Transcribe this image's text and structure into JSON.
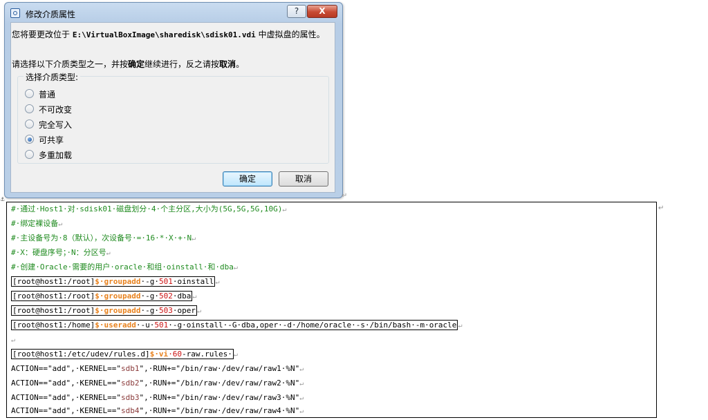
{
  "dialog": {
    "title": "修改介质属性",
    "help_label": "?",
    "close_label": "X",
    "msg_prefix": "您将要更改位于",
    "msg_path": "E:\\VirtualBoxImage\\sharedisk\\sdisk01.vdi",
    "msg_suffix": "中虚拟盘的属性。",
    "instr_part1": "请选择以下介质类型之一，并按",
    "instr_ok": "确定",
    "instr_part2": "继续进行，反之请按",
    "instr_cancel": "取消",
    "instr_end": "。",
    "group_label": "选择介质类型:",
    "options": [
      {
        "label": "普通",
        "checked": false
      },
      {
        "label": "不可改变",
        "checked": false
      },
      {
        "label": "完全写入",
        "checked": false
      },
      {
        "label": "可共享",
        "checked": true
      },
      {
        "label": "多重加载",
        "checked": false
      }
    ],
    "ok_label": "确定",
    "cancel_label": "取消"
  },
  "code": {
    "comments": [
      "#·通过·Host1·对·sdisk01·磁盘划分·4·个主分区,大小为(5G,5G,5G,10G)",
      "#·绑定裸设备",
      "#·主设备号为·8（默认），次设备号·=·16·*·X·+·N",
      "#·X：硬盘序号；·N：分区号",
      "#·创建·Oracle·需要的用户·oracle·和组·oinstall·和·dba"
    ],
    "commands": [
      {
        "prompt": "[root@host1:/root]",
        "cmd": "·groupadd",
        "args_pre": "·-g·",
        "num": "501",
        "args_post": "·oinstall"
      },
      {
        "prompt": "[root@host1:/root]",
        "cmd": "·groupadd",
        "args_pre": "·-g·",
        "num": "502",
        "args_post": "·dba"
      },
      {
        "prompt": "[root@host1:/root]",
        "cmd": "·groupadd",
        "args_pre": "·-g·",
        "num": "503",
        "args_post": "·oper"
      },
      {
        "prompt": "[root@host1:/home]",
        "cmd": "·useradd",
        "args_pre": "·-u·",
        "num": "501",
        "args_post": "·-g·oinstall·-G·dba,oper·-d·/home/oracle·-s·/bin/bash·-m·oracle"
      }
    ],
    "vi_line": {
      "prompt": "[root@host1:/etc/udev/rules.d]",
      "cmd": "·vi",
      "num": "·60",
      "rest": "-raw.rules·"
    },
    "rules": [
      {
        "pre": "ACTION==\"add\",·KERNEL==\"",
        "dev": "sdb1",
        "post": "\",·RUN+=\"/bin/raw·/dev/raw/raw1·%N\""
      },
      {
        "pre": "ACTION==\"add\",·KERNEL==\"",
        "dev": "sdb2",
        "post": "\",·RUN+=\"/bin/raw·/dev/raw/raw2·%N\""
      },
      {
        "pre": "ACTION==\"add\",·KERNEL==\"",
        "dev": "sdb3",
        "post": "\",·RUN+=\"/bin/raw·/dev/raw/raw3·%N\""
      },
      {
        "pre": "ACTION==\"add\",·KERNEL==\"",
        "dev": "sdb4",
        "post": "\",·RUN+=\"/bin/raw·/dev/raw/raw4·%N\""
      }
    ],
    "para_mark": "↵",
    "dollar": "$"
  }
}
